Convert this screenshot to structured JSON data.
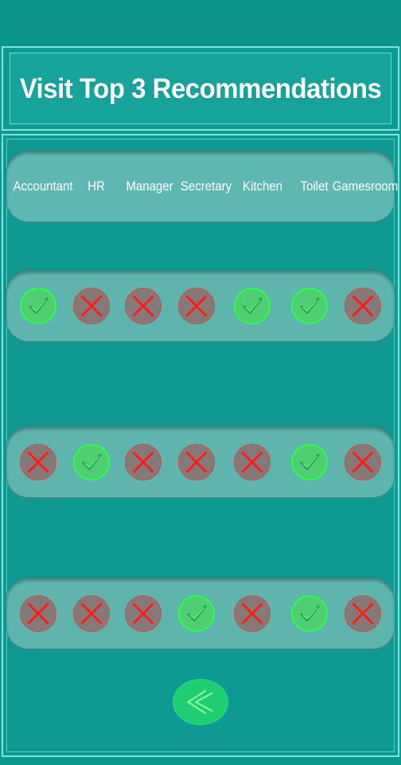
{
  "title": "Visit Top 3 Recommendations",
  "columns": [
    "Accountant",
    "HR",
    "Manager",
    "Secretary",
    "Kitchen",
    "Toilet",
    "Gamesroom"
  ],
  "rows": [
    [
      "check",
      "cross",
      "cross",
      "cross",
      "check",
      "check",
      "cross"
    ],
    [
      "cross",
      "check",
      "cross",
      "cross",
      "cross",
      "check",
      "cross"
    ],
    [
      "cross",
      "cross",
      "cross",
      "check",
      "cross",
      "check",
      "cross"
    ]
  ],
  "icons": {
    "check": "checkmark-icon",
    "cross": "cross-icon",
    "back": "double-chevron-left-icon"
  },
  "colors": {
    "background": "#0e9a92",
    "check_fill": "#50ce72",
    "check_stroke": "#2bff4a",
    "cross_fill": "#857a77",
    "cross_stroke": "#ff1a1a",
    "back_button": "#1fce73"
  }
}
